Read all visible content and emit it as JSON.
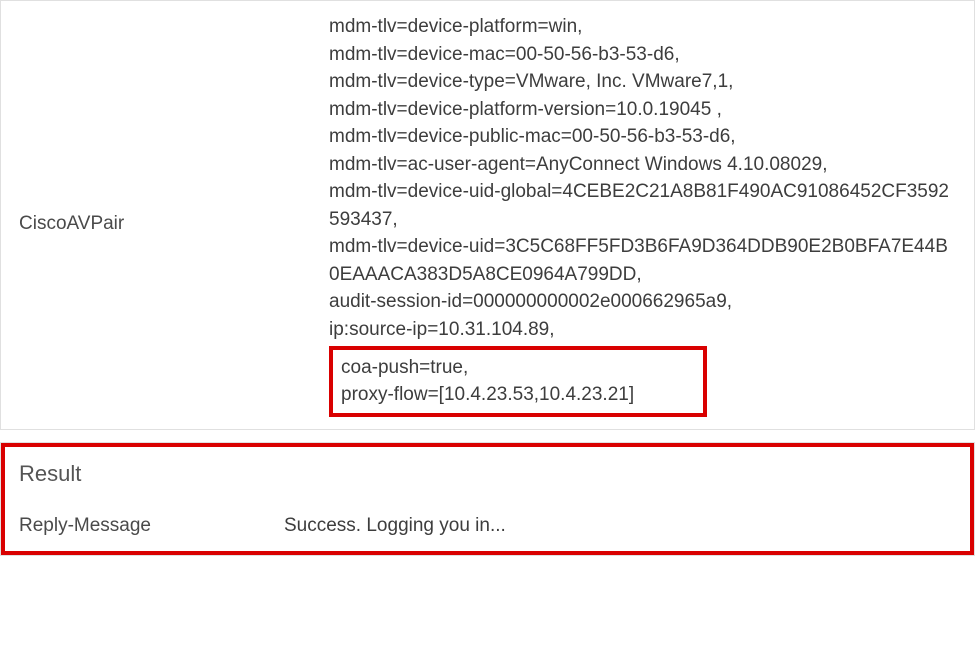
{
  "avpair": {
    "label": "CiscoAVPair",
    "lines": [
      "mdm-tlv=device-platform=win,",
      "mdm-tlv=device-mac=00-50-56-b3-53-d6,",
      "mdm-tlv=device-type=VMware, Inc. VMware7,1,",
      "mdm-tlv=device-platform-version=10.0.19045 ,",
      "mdm-tlv=device-public-mac=00-50-56-b3-53-d6,",
      "mdm-tlv=ac-user-agent=AnyConnect Windows 4.10.08029,",
      "mdm-tlv=device-uid-global=4CEBE2C21A8B81F490AC91086452CF3592593437,",
      "mdm-tlv=device-uid=3C5C68FF5FD3B6FA9D364DDB90E2B0BFA7E44B0EAAACA383D5A8CE0964A799DD,",
      "audit-session-id=000000000002e000662965a9,",
      "ip:source-ip=10.31.104.89,"
    ],
    "highlighted": [
      "coa-push=true,",
      "proxy-flow=[10.4.23.53,10.4.23.21]"
    ]
  },
  "result": {
    "heading": "Result",
    "reply_label": "Reply-Message",
    "reply_value": "Success. Logging you in..."
  }
}
